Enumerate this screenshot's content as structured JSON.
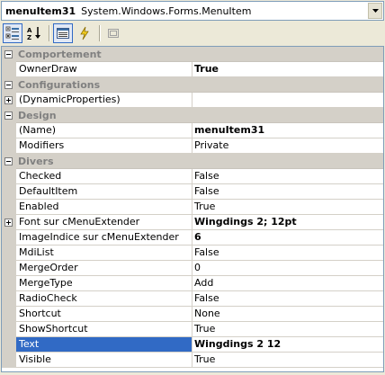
{
  "object_selector": {
    "name": "menuItem31",
    "type": "System.Windows.Forms.MenuItem"
  },
  "toolbar": {
    "buttons": [
      {
        "icon": "categorized-icon",
        "active": true
      },
      {
        "icon": "alphabetical-icon",
        "active": false
      },
      {
        "icon": "properties-icon",
        "active": true
      },
      {
        "icon": "events-icon",
        "active": false
      },
      {
        "icon": "property-pages-icon",
        "active": false
      }
    ]
  },
  "grid": {
    "categories": [
      {
        "label": "Comportement",
        "properties": [
          {
            "name": "OwnerDraw",
            "value": "True",
            "bold": true
          }
        ]
      },
      {
        "label": "Configurations",
        "properties": [
          {
            "name": "(DynamicProperties)",
            "value": "",
            "expandable": true
          }
        ]
      },
      {
        "label": "Design",
        "properties": [
          {
            "name": "(Name)",
            "value": "menuItem31",
            "bold": true
          },
          {
            "name": "Modifiers",
            "value": "Private"
          }
        ]
      },
      {
        "label": "Divers",
        "properties": [
          {
            "name": "Checked",
            "value": "False"
          },
          {
            "name": "DefaultItem",
            "value": "False"
          },
          {
            "name": "Enabled",
            "value": "True"
          },
          {
            "name": "Font sur cMenuExtender",
            "value": "Wingdings 2; 12pt",
            "bold": true,
            "expandable": true
          },
          {
            "name": "ImageIndice sur cMenuExtender",
            "value": "6",
            "bold": true
          },
          {
            "name": "MdiList",
            "value": "False"
          },
          {
            "name": "MergeOrder",
            "value": "0"
          },
          {
            "name": "MergeType",
            "value": "Add"
          },
          {
            "name": "RadioCheck",
            "value": "False"
          },
          {
            "name": "Shortcut",
            "value": "None"
          },
          {
            "name": "ShowShortcut",
            "value": "True"
          },
          {
            "name": "Text",
            "value": "Wingdings 2 12",
            "bold": true,
            "selected": true
          },
          {
            "name": "Visible",
            "value": "True"
          }
        ]
      }
    ]
  },
  "colors": {
    "selection": "#316ac5",
    "category_text": "#808080",
    "gutter": "#d4d0c8"
  }
}
